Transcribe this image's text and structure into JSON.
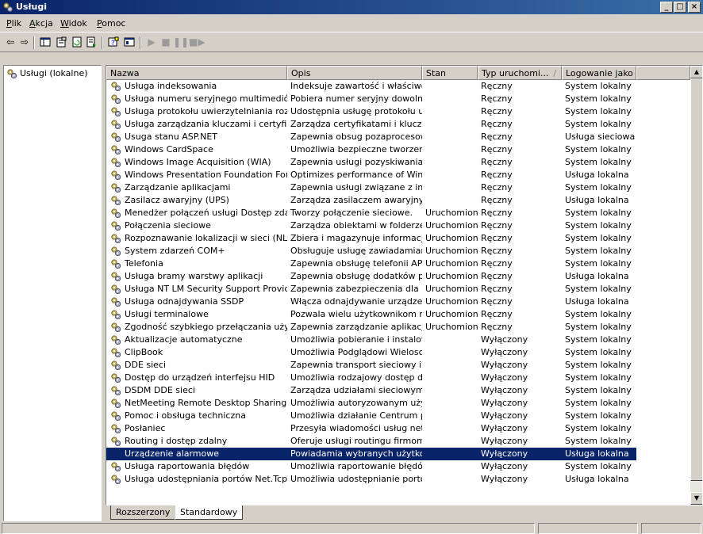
{
  "window": {
    "title": "Usługi"
  },
  "menu": [
    "Plik",
    "Akcja",
    "Widok",
    "Pomoc"
  ],
  "tree": {
    "root_label": "Usługi (lokalne)"
  },
  "columns": [
    "Nazwa",
    "Opis",
    "Stan",
    "Typ uruchomi...",
    "Logowanie jako"
  ],
  "sort_indicator": "/",
  "selected_index": 29,
  "services": [
    [
      "Usługa indeksowania",
      "Indeksuje zawartość i właściwo...",
      "",
      "Ręczny",
      "System lokalny"
    ],
    [
      "Usługa numeru seryjnego multimediów pr...",
      "Pobiera numer seryjny dowolne...",
      "",
      "Ręczny",
      "System lokalny"
    ],
    [
      "Usługa protokołu uwierzytelniania rozsze...",
      "Udostępnia usługę protokołu u...",
      "",
      "Ręczny",
      "System lokalny"
    ],
    [
      "Usługa zarządzania kluczami i certyfikata...",
      "Zarządza certyfikatami i klucza...",
      "",
      "Ręczny",
      "System lokalny"
    ],
    [
      "Usuga stanu ASP.NET",
      "Zapewnia obsug pozaprocesow...",
      "",
      "Ręczny",
      "Usługa sieciowa"
    ],
    [
      "Windows CardSpace",
      "Umożliwia bezpieczne tworzeni...",
      "",
      "Ręczny",
      "System lokalny"
    ],
    [
      "Windows Image Acquisition (WIA)",
      "Zapewnia usługi pozyskiwania ...",
      "",
      "Ręczny",
      "System lokalny"
    ],
    [
      "Windows Presentation Foundation Font C...",
      "Optimizes performance of Wind...",
      "",
      "Ręczny",
      "Usługa lokalna"
    ],
    [
      "Zarządzanie aplikacjami",
      "Zapewnia usługi związane z ins...",
      "",
      "Ręczny",
      "System lokalny"
    ],
    [
      "Zasilacz awaryjny (UPS)",
      "Zarządza zasilaczem awaryjny...",
      "",
      "Ręczny",
      "Usługa lokalna"
    ],
    [
      "Menedżer połączeń usługi Dostęp zdalny",
      "Tworzy połączenie sieciowe.",
      "Uruchomiono",
      "Ręczny",
      "System lokalny"
    ],
    [
      "Połączenia sieciowe",
      "Zarządza obiektami w folderze ...",
      "Uruchomiono",
      "Ręczny",
      "System lokalny"
    ],
    [
      "Rozpoznawanie lokalizacji w sieci (NLA)",
      "Zbiera i magazynuje informacje...",
      "Uruchomiono",
      "Ręczny",
      "System lokalny"
    ],
    [
      "System zdarzeń COM+",
      "Obsługuje usługę zawiadamiani...",
      "Uruchomiono",
      "Ręczny",
      "System lokalny"
    ],
    [
      "Telefonia",
      "Zapewnia obsługę telefonii API ...",
      "Uruchomiono",
      "Ręczny",
      "System lokalny"
    ],
    [
      "Usługa bramy warstwy aplikacji",
      "Zapewnia obsługę dodatków pr...",
      "Uruchomiono",
      "Ręczny",
      "Usługa lokalna"
    ],
    [
      "Usługa NT LM Security Support Provider",
      "Zapewnia zabezpieczenia dla pr...",
      "Uruchomiono",
      "Ręczny",
      "System lokalny"
    ],
    [
      "Usługa odnajdywania SSDP",
      "Włącza odnajdywanie urządze...",
      "Uruchomiono",
      "Ręczny",
      "Usługa lokalna"
    ],
    [
      "Usługi terminalowe",
      "Pozwala wielu użytkownikom na...",
      "Uruchomiono",
      "Ręczny",
      "System lokalny"
    ],
    [
      "Zgodność szybkiego przełączania użytko...",
      "Zapewnia zarządzanie aplikacja...",
      "Uruchomiono",
      "Ręczny",
      "System lokalny"
    ],
    [
      "Aktualizacje automatyczne",
      "Umożliwia pobieranie i instalow...",
      "",
      "Wyłączony",
      "System lokalny"
    ],
    [
      "ClipBook",
      "Umożliwia Podglądowi Wielosch...",
      "",
      "Wyłączony",
      "System lokalny"
    ],
    [
      "DDE sieci",
      "Zapewnia transport sieciowy i z...",
      "",
      "Wyłączony",
      "System lokalny"
    ],
    [
      "Dostęp do urządzeń interfejsu HID",
      "Umożliwia rodzajowy dostęp do...",
      "",
      "Wyłączony",
      "System lokalny"
    ],
    [
      "DSDM DDE sieci",
      "Zarządza udziałami sieciowymi ...",
      "",
      "Wyłączony",
      "System lokalny"
    ],
    [
      "NetMeeting Remote Desktop Sharing",
      "Umożliwia autoryzowanym użyt...",
      "",
      "Wyłączony",
      "System lokalny"
    ],
    [
      "Pomoc i obsługa techniczna",
      "Umożliwia działanie Centrum po...",
      "",
      "Wyłączony",
      "System lokalny"
    ],
    [
      "Posłaniec",
      "Przesyła wiadomości usług net ...",
      "",
      "Wyłączony",
      "System lokalny"
    ],
    [
      "Routing i dostęp zdalny",
      "Oferuje usługi routingu firmom ...",
      "",
      "Wyłączony",
      "System lokalny"
    ],
    [
      "Urządzenie alarmowe",
      "Powiadamia wybranych użytko...",
      "",
      "Wyłączony",
      "Usługa lokalna"
    ],
    [
      "Usługa raportowania błędów",
      "Umożliwia raportowanie błędów...",
      "",
      "Wyłączony",
      "System lokalny"
    ],
    [
      "Usługa udostępniania portów Net.Tcp",
      "Umożliwia udostępnianie portó...",
      "",
      "Wyłączony",
      "Usługa lokalna"
    ]
  ],
  "tabs": [
    "Rozszerzony",
    "Standardowy"
  ],
  "colors": {
    "titlebar": "#0a246a",
    "selection": "#0a246a",
    "face": "#d4d0c8"
  }
}
